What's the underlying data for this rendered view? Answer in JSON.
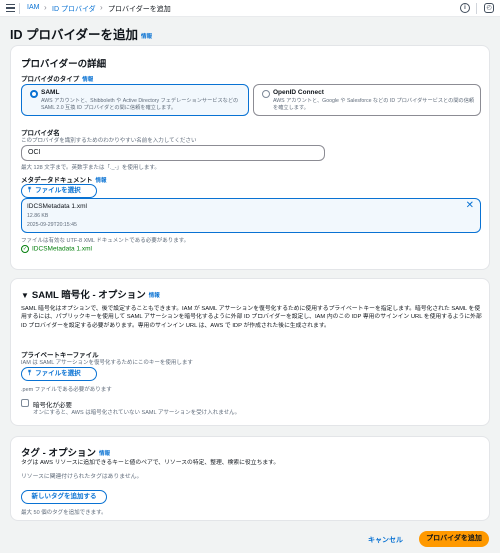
{
  "header": {
    "breadcrumbs": [
      "IAM",
      "ID プロバイダ",
      "プロバイダーを追加"
    ],
    "help_icon": "help-circle-icon",
    "notification_icon": "notification-icon"
  },
  "page": {
    "title": "ID プロバイダーを追加",
    "info": "情報"
  },
  "details": {
    "heading": "プロバイダーの詳細",
    "provider_type": {
      "label": "プロバイダのタイプ",
      "info": "情報",
      "options": [
        {
          "title": "SAML",
          "desc": "AWS アカウントと、Shibboleth や Active Directory フェデレーションサービスなどの SAML 2.0 互換 ID プロバイダとの間に信頼を確立します。",
          "selected": true
        },
        {
          "title": "OpenID Connect",
          "desc": "AWS アカウントと、Google や Salesforce などの ID プロバイダサービスとの間の信頼を確立します。",
          "selected": false
        }
      ]
    },
    "provider_name": {
      "label": "プロバイダ名",
      "desc": "このプロバイダを識別するためのわかりやすい名前を入力してください",
      "value": "OCI",
      "hint": "最大 128 文字まで。英数字または「._-」を使用します。"
    },
    "metadata": {
      "label": "メタデータドキュメント",
      "info": "情報",
      "button": "ファイルを選択",
      "file": {
        "name": "IDCSMetadata 1.xml",
        "size": "12.86 KB",
        "date": "2025-09-29T20:15:45"
      },
      "hint": "ファイルは有効な UTF-8 XML ドキュメントである必要があります。",
      "success": "IDCSMetadata 1.xml"
    }
  },
  "encryption": {
    "heading": "SAML 暗号化 - オプション",
    "info": "情報",
    "paragraph": "SAML 暗号化はオプションで、後で設定することもできます。IAM が SAML アサーションを復号化するために使用するプライベートキーを指定します。暗号化された SAML を使用するには、パブリックキーを使用して SAML アサーションを暗号化するように外部 ID プロバイダーを設定し、IAM 内のこの IDP 専用のサインイン URL を使用するように外部 ID プロバイダーを設定する必要があります。専用のサインイン URL は、AWS で IDP が作成された後に生成されます。",
    "private_key": {
      "label": "プライベートキーファイル",
      "desc": "IAM は SAML アサーションを復号化するためにこのキーを使用します",
      "button": "ファイルを選択",
      "hint": ".pem ファイルである必要があります"
    },
    "require": {
      "label": "暗号化が必要",
      "desc": "オンにすると、AWS は暗号化されていない SAML アサーションを受け入れません。",
      "checked": false
    }
  },
  "tags": {
    "heading": "タグ - オプション",
    "info": "情報",
    "desc": "タグは AWS リソースに追加できるキーと値のペアで、リソースの特定、整理、検索に役立ちます。",
    "empty": "リソースに関連付けられたタグはありません。",
    "add_button": "新しいタグを追加する",
    "limit": "最大 50 個のタグを追加できます。"
  },
  "footer": {
    "cancel": "キャンセル",
    "submit": "プロバイダを追加"
  },
  "colors": {
    "accent": "#0972d3",
    "primary": "#ff9900",
    "success": "#037f0c"
  }
}
